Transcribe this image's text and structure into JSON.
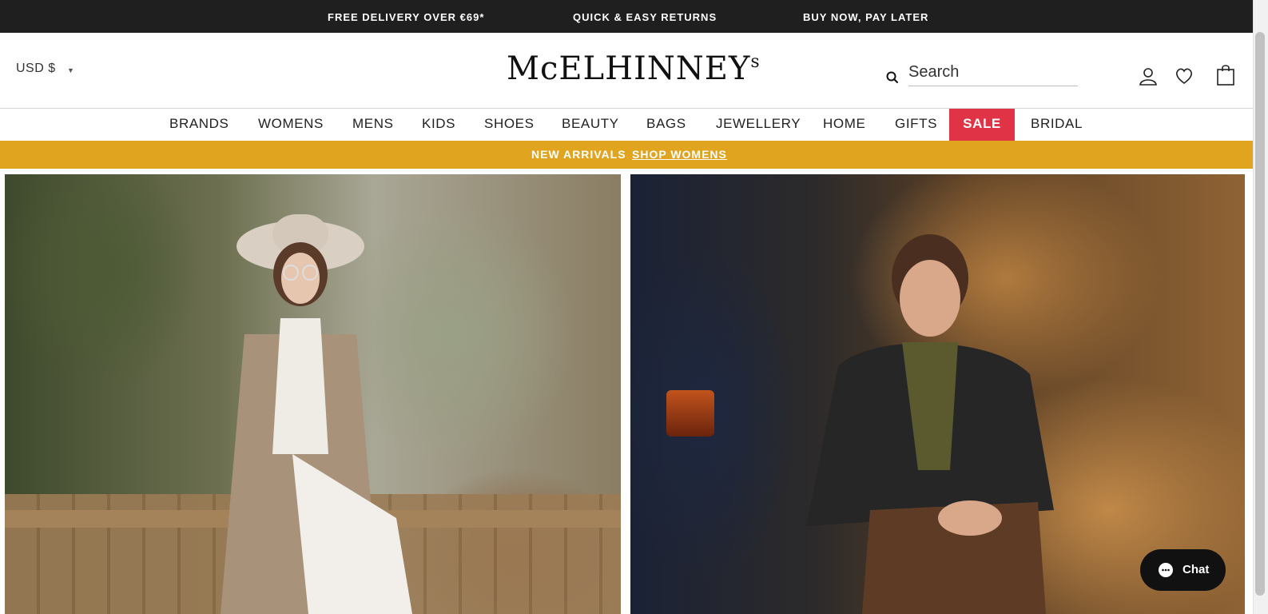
{
  "announcement": {
    "items": [
      "FREE DELIVERY OVER €69*",
      "QUICK & EASY RETURNS",
      "BUY NOW, PAY LATER"
    ]
  },
  "header": {
    "currency": "USD $",
    "logo_main": "McELHINNEY",
    "logo_sup": "s",
    "search_placeholder": "Search",
    "icons": [
      "search-icon",
      "account-icon",
      "wishlist-heart-icon",
      "shopping-bag-icon"
    ]
  },
  "nav": {
    "items": [
      "BRANDS",
      "WOMENS",
      "MENS",
      "KIDS",
      "SHOES",
      "BEAUTY",
      "BAGS",
      "JEWELLERY",
      "HOME",
      "GIFTS",
      "SALE",
      "BRIDAL"
    ]
  },
  "promo": {
    "label": "NEW ARRIVALS",
    "link": "SHOP WOMENS"
  },
  "chat": {
    "label": "Chat"
  },
  "colors": {
    "announcement_bg": "#1f1f1f",
    "promo_bg": "#e0a41f",
    "sale_bg": "#e03346"
  }
}
